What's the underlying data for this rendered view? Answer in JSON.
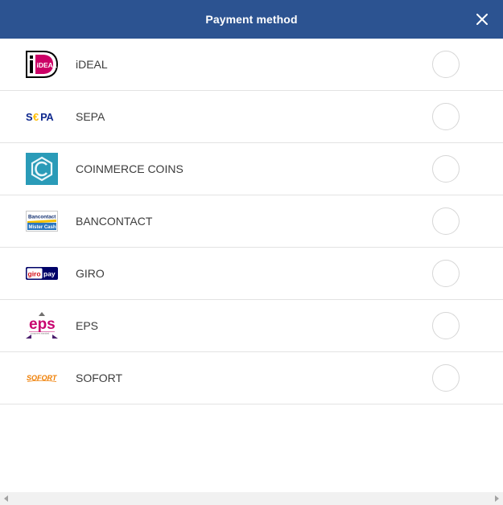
{
  "header": {
    "title": "Payment method",
    "close_icon": "close-icon",
    "background": "#2c5391"
  },
  "methods": [
    {
      "label": "iDEAL",
      "logo_text": "iDEAL",
      "icon": "ideal-logo"
    },
    {
      "label": "SEPA",
      "logo_text": "SEPA",
      "icon": "sepa-logo"
    },
    {
      "label": "COINMERCE COINS",
      "icon": "coinmerce-logo"
    },
    {
      "label": "BANCONTACT",
      "logo_text_top": "Bancontact",
      "logo_text_bottom": "Mister Cash",
      "icon": "bancontact-logo"
    },
    {
      "label": "GIRO",
      "logo_text_left": "giro",
      "logo_text_right": "pay",
      "icon": "giropay-logo"
    },
    {
      "label": "EPS",
      "logo_text": "eps",
      "logo_subtext": "e-payment standard",
      "icon": "eps-logo"
    },
    {
      "label": "SOFORT",
      "logo_text": "SOFORT",
      "icon": "sofort-logo"
    }
  ],
  "colors": {
    "header": "#2c5391",
    "divider": "#e3e3e3",
    "radio_border": "#d6d6d6",
    "text": "#3c3c3c"
  }
}
